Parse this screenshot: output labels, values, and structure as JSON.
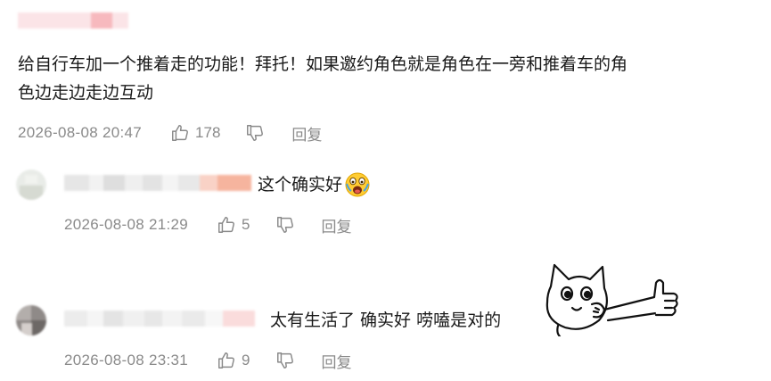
{
  "comments": [
    {
      "text_line1": "给自行车加一个推着走的功能！拜托！如果邀约角色就是角色在一旁和推着车的角",
      "text_line2": "色边走边走边互动",
      "time": "2026-08-08 20:47",
      "likes": "178",
      "reply_label": "回复"
    },
    {
      "text": "这个确实好",
      "emoji": "scared-face-emoji",
      "time": "2026-08-08 21:29",
      "likes": "5",
      "reply_label": "回复"
    },
    {
      "text": "太有生活了 确实好 唠嗑是对的",
      "sticker": "cat-thumbs-up-sticker",
      "time": "2026-08-08 23:31",
      "likes": "9",
      "reply_label": "回复"
    }
  ],
  "icons": {
    "like": "thumbs-up-icon",
    "dislike": "thumbs-down-icon"
  },
  "colors": {
    "meta_text": "#8a8a8a",
    "comment_text": "#1a1a1a",
    "background": "#ffffff"
  }
}
